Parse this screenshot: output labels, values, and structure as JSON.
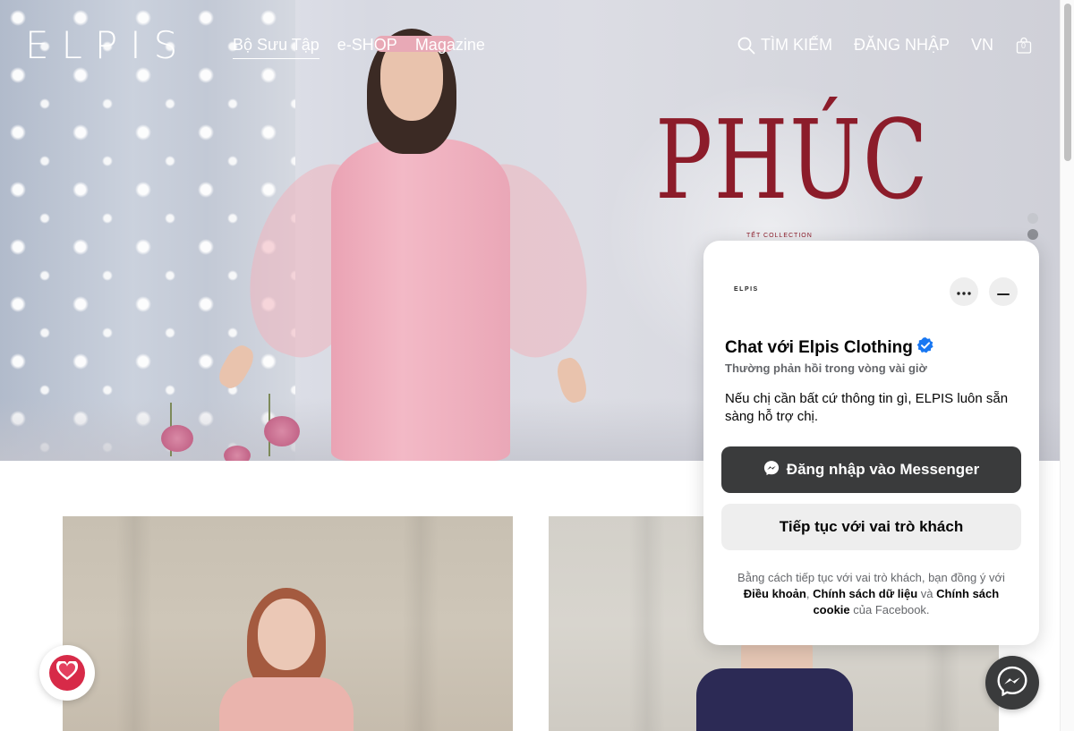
{
  "header": {
    "logo": "ELPIS",
    "nav": [
      "Bộ Sưu Tập",
      "e-SHOP",
      "Magazine"
    ],
    "search_label": "TÌM KIẾM",
    "login_label": "ĐĂNG NHẬP",
    "language": "VN",
    "cart_count": "0"
  },
  "hero": {
    "campaign_title": "PHÚC",
    "campaign_subtitle": "TẾT COLLECTION",
    "slides_count": 2,
    "active_slide": 2
  },
  "chat": {
    "brand_logo": "ELPIS",
    "title": "Chat với Elpis Clothing",
    "response_time": "Thường phản hồi trong vòng vài giờ",
    "message": "Nếu chị cần bất cứ thông tin gì, ELPIS luôn sẵn sàng hỗ trợ chị.",
    "primary_button": "Đăng nhập vào Messenger",
    "secondary_button": "Tiếp tục với vai trò khách",
    "legal_prefix": "Bằng cách tiếp tục với vai trò khách, bạn đồng ý với",
    "legal_terms": "Điều khoản",
    "legal_sep1": ",",
    "legal_data_policy": "Chính sách dữ liệu",
    "legal_and": "và",
    "legal_cookie_policy": "Chính sách cookie",
    "legal_suffix": "của Facebook."
  },
  "colors": {
    "campaign_red": "#8c1c2a",
    "chat_dark_button": "#3a3b3c",
    "heart_red": "#d72a48",
    "verified_blue": "#1877f2"
  },
  "icons": {
    "search": "search-icon",
    "bag": "shopping-bag-icon",
    "more": "more-horizontal-icon",
    "minimize": "minimize-icon",
    "verified": "verified-badge-icon",
    "messenger": "messenger-icon",
    "heart": "heart-icon"
  }
}
